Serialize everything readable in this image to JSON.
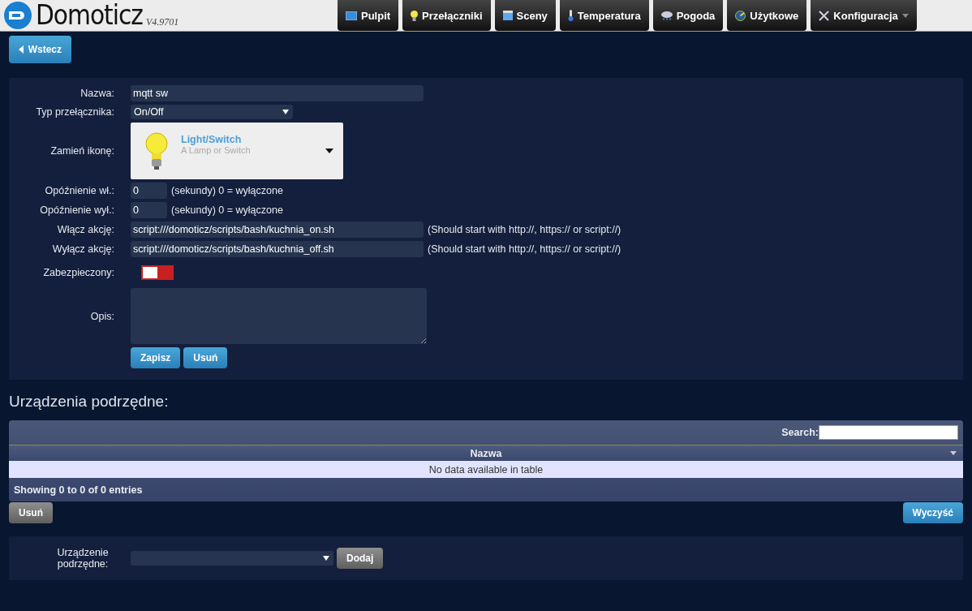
{
  "header": {
    "logo": "Domoticz",
    "version": "V4.9701"
  },
  "nav": [
    {
      "label": "Pulpit",
      "selected": false,
      "dropdown": false
    },
    {
      "label": "Przełączniki",
      "selected": false,
      "dropdown": false
    },
    {
      "label": "Sceny",
      "selected": false,
      "dropdown": false
    },
    {
      "label": "Temperatura",
      "selected": false,
      "dropdown": false
    },
    {
      "label": "Pogoda",
      "selected": false,
      "dropdown": false
    },
    {
      "label": "Użytkowe",
      "selected": false,
      "dropdown": false
    },
    {
      "label": "Konfiguracja",
      "selected": false,
      "dropdown": true
    }
  ],
  "back_button": "Wstecz",
  "form": {
    "name": {
      "label": "Nazwa:",
      "value": "mqtt sw"
    },
    "switch_type": {
      "label": "Typ przełącznika:",
      "value": "On/Off"
    },
    "icon": {
      "label": "Zamień ikonę:",
      "title": "Light/Switch",
      "subtitle": "A Lamp or Switch"
    },
    "on_delay": {
      "label": "Opóźnienie wł.:",
      "value": "0",
      "hint": "(sekundy) 0 = wyłączone"
    },
    "off_delay": {
      "label": "Opóźnienie wył.:",
      "value": "0",
      "hint": "(sekundy) 0 = wyłączone"
    },
    "on_action": {
      "label": "Włącz akcję:",
      "value": "script:///domoticz/scripts/bash/kuchnia_on.sh",
      "hint": "(Should start with http://, https:// or script://)"
    },
    "off_action": {
      "label": "Wyłącz akcję:",
      "value": "script:///domoticz/scripts/bash/kuchnia_off.sh",
      "hint": "(Should start with http://, https:// or script://)"
    },
    "protected": {
      "label": "Zabezpieczony:",
      "on": false
    },
    "description": {
      "label": "Opis:"
    },
    "buttons": [
      "Zapisz",
      "Usuń"
    ]
  },
  "subdevices": {
    "title": "Urządzenia podrzędne:",
    "search_label": "Search:",
    "columns": [
      "Nazwa"
    ],
    "empty": "No data available in table",
    "info": "Showing 0 to 0 of 0 entries",
    "delete_button": "Usuń",
    "clear_button": "Wyczyść"
  },
  "add": {
    "label": "Urządzenie podrzędne:",
    "button": "Dodaj"
  }
}
